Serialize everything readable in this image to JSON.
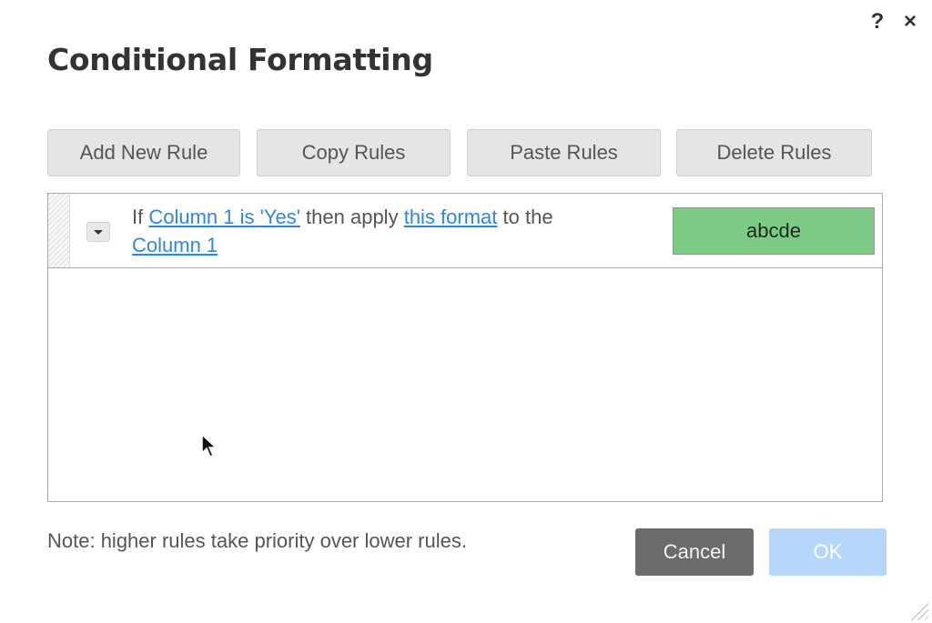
{
  "dialog": {
    "title": "Conditional Formatting",
    "help_label": "?",
    "close_label": "×"
  },
  "toolbar": {
    "buttons": [
      {
        "label": "Add New Rule"
      },
      {
        "label": "Copy Rules"
      },
      {
        "label": "Paste Rules"
      },
      {
        "label": "Delete Rules"
      }
    ]
  },
  "rules": [
    {
      "prefix": "If",
      "condition_link": "Column 1 is 'Yes'",
      "middle": "then apply",
      "format_link": "this format",
      "suffix": "to the",
      "target_link": "Column 1",
      "preview_text": "abcde",
      "preview_bg": "#7ccb84"
    }
  ],
  "footer": {
    "note": "Note: higher rules take priority over lower rules.",
    "cancel_label": "Cancel",
    "ok_label": "OK"
  },
  "colors": {
    "link": "#2f86e0",
    "cancel_bg": "#6b6b6b",
    "ok_bg_disabled": "#b5d7fb"
  }
}
